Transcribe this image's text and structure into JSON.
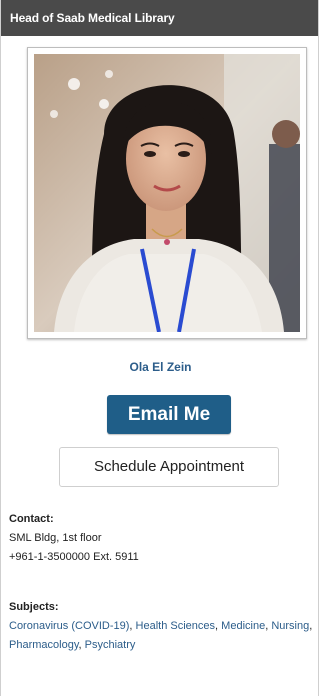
{
  "header": {
    "title": "Head of Saab Medical Library"
  },
  "profile": {
    "name": "Ola El Zein",
    "email_label": "Email Me",
    "schedule_label": "Schedule Appointment"
  },
  "contact": {
    "label": "Contact:",
    "line1": "SML Bldg, 1st floor",
    "line2": "+961-1-3500000 Ext. 5911"
  },
  "subjects": {
    "label": "Subjects:",
    "items": [
      "Coronavirus (COVID-19)",
      "Health Sciences",
      "Medicine",
      "Nursing",
      "Pharmacology",
      "Psychiatry"
    ]
  },
  "colors": {
    "header_bg": "#4a4a4a",
    "accent": "#1f5e88",
    "link": "#2c5d8a"
  }
}
